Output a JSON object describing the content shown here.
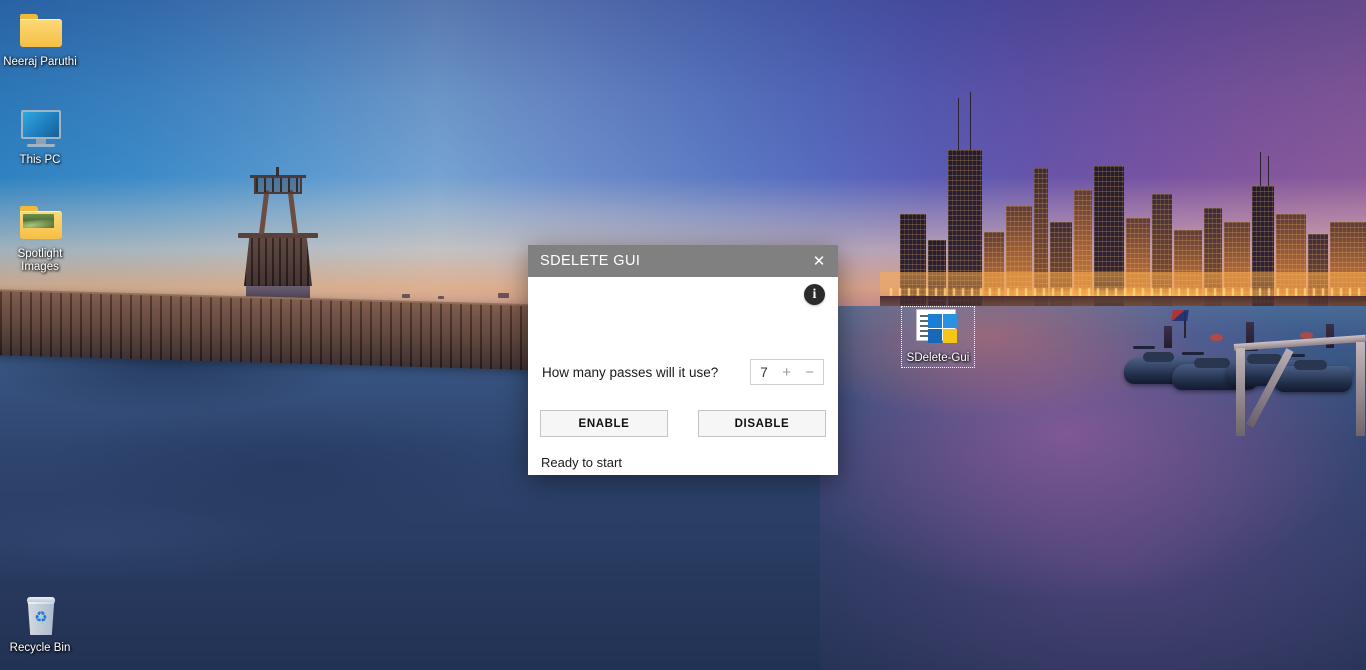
{
  "desktop": {
    "icons": [
      {
        "name": "Neeraj Paruthi",
        "type": "folder-icon",
        "selected": false
      },
      {
        "name": "This PC",
        "type": "computer-icon",
        "selected": false
      },
      {
        "name": "Spotlight Images",
        "type": "picture-folder-icon",
        "selected": false
      },
      {
        "name": "Recycle Bin",
        "type": "recycle-bin-icon",
        "selected": false
      },
      {
        "name": "SDelete-Gui",
        "type": "application-icon",
        "selected": true
      }
    ],
    "wallpaper_description": "Chicago skyline at sunset over water with pier and lighthouse"
  },
  "dialog": {
    "title": "SDELETE GUI",
    "close_label": "✕",
    "info_label": "i",
    "passes_label": "How many passes will it use?",
    "passes_value": "7",
    "increment_label": "+",
    "decrement_label": "−",
    "enable_label": "ENABLE",
    "disable_label": "DISABLE",
    "status": "Ready to start"
  },
  "colors": {
    "titlebar": "#808080",
    "dialog_background": "#ffffff",
    "button_face": "#f6f6f6",
    "info_badge": "#2b2b2b",
    "accent_sky_blue": "#2f86c5",
    "accent_sky_purple": "#8e5c9c",
    "city_light": "#ffb74d"
  }
}
